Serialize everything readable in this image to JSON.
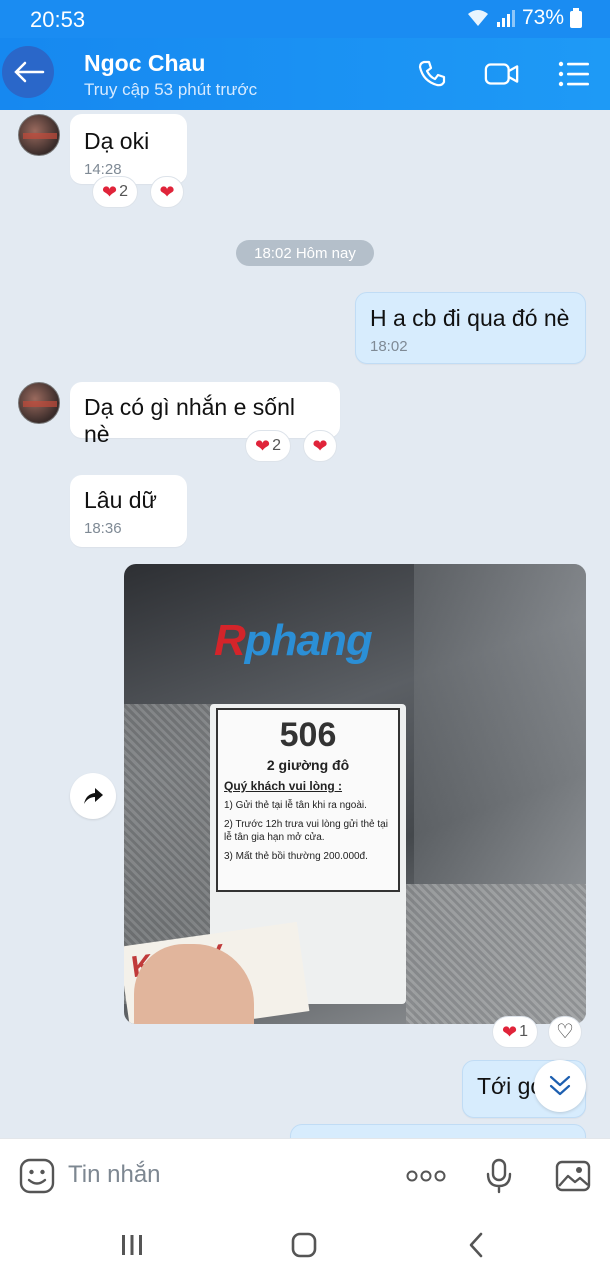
{
  "status_bar": {
    "time": "20:53",
    "battery": "73%"
  },
  "header": {
    "contact_name": "Ngoc Chau",
    "contact_status": "Truy cập 53 phút trước"
  },
  "messages": [
    {
      "text": "Dạ oki",
      "time": "14:28",
      "reactions": {
        "heart_count": "2"
      }
    },
    {
      "text": "H a cb đi qua đó nè",
      "time": "18:02"
    },
    {
      "text": "Dạ có gì nhắn e sốnl nè",
      "reactions": {
        "heart_count": "2"
      }
    },
    {
      "text": "Lâu dữ",
      "time": "18:36"
    },
    {
      "text": "Tới go"
    }
  ],
  "date_chip": "18:02 Hôm nay",
  "photo": {
    "watermark_r": "R",
    "watermark_rest": "phang",
    "card_number": "506",
    "card_beds": "2 giường đô",
    "card_heading": "Quý khách vui lòng :",
    "card_lines": [
      "1) Gửi thẻ tại lễ tân khi ra ngoài.",
      "2) Trước 12h trưa vui lòng gửi thẻ tại lễ tân gia hạn mở cửa.",
      "3) Mất thẻ bồi thường 200.000đ."
    ],
    "ticket_text": "K.S  LY",
    "reactions": {
      "heart_count": "1"
    }
  },
  "composer": {
    "placeholder": "Tin nhắn"
  },
  "colors": {
    "header": "#1a8cf2",
    "mine_bubble": "#d7ecfd",
    "background": "#e3eaf2",
    "heart": "#e0243a"
  }
}
